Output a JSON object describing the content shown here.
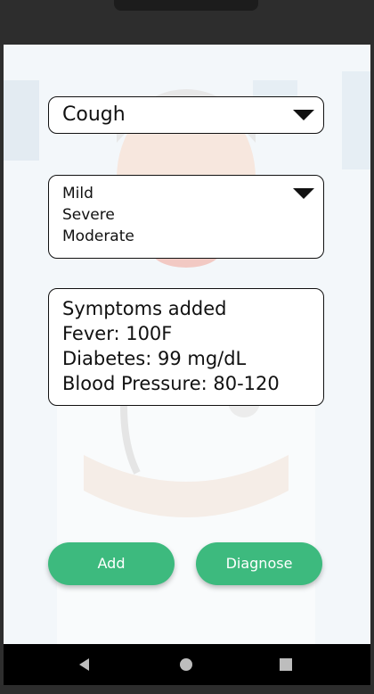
{
  "symptom_dropdown": {
    "selected": "Cough",
    "caret_icon": "triangle-down"
  },
  "severity_dropdown": {
    "options": [
      "Mild",
      "Severe",
      "Moderate"
    ],
    "caret_icon": "triangle-down"
  },
  "summary": {
    "lines": [
      "Symptoms added",
      "Fever: 100F",
      "Diabetes: 99 mg/dL",
      "Blood Pressure: 80-120"
    ]
  },
  "buttons": {
    "add_label": "Add",
    "diagnose_label": "Diagnose"
  },
  "nav": {
    "back_icon": "back-triangle",
    "home_icon": "home-circle",
    "recents_icon": "recents-square"
  },
  "colors": {
    "primary": "#3dba7e",
    "navbar": "#000000"
  }
}
